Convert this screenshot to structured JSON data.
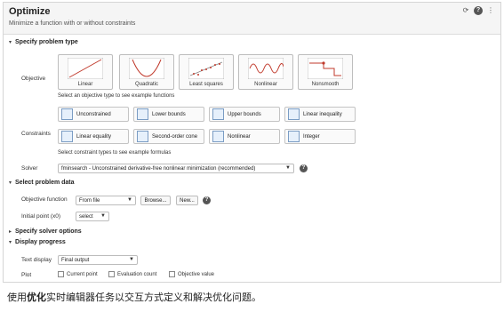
{
  "header": {
    "title": "Optimize",
    "subtitle": "Minimize a function with or without constraints"
  },
  "sections": {
    "problem_type": "Specify problem type",
    "problem_data": "Select problem data",
    "solver_options": "Specify solver options",
    "display_progress": "Display progress"
  },
  "objective": {
    "label": "Objective",
    "tiles": [
      "Linear",
      "Quadratic",
      "Least squares",
      "Nonlinear",
      "Nonsmooth"
    ],
    "hint": "Select an objective type to see example functions"
  },
  "constraints": {
    "label": "Constraints",
    "buttons": [
      "Unconstrained",
      "Lower bounds",
      "Upper bounds",
      "Linear inequality",
      "Linear equality",
      "Second-order cone",
      "Nonlinear",
      "Integer"
    ],
    "hint": "Select constraint types to see example formulas"
  },
  "solver": {
    "label": "Solver",
    "value": "fminsearch - Unconstrained derivative-free nonlinear minimization (recommended)"
  },
  "problem_data": {
    "objective_function_label": "Objective function",
    "objective_function_value": "From file",
    "browse_label": "Browse...",
    "new_label": "New...",
    "initial_point_label": "Initial point (x0)",
    "initial_point_value": "select"
  },
  "display": {
    "text_display_label": "Text display",
    "text_display_value": "Final output",
    "plot_label": "Plot",
    "plot_options": [
      "Current point",
      "Evaluation count",
      "Objective value"
    ]
  },
  "caption": {
    "before": "使用",
    "bold": "优化",
    "after": "实时编辑器任务以交互方式定义和解决优化问题。"
  },
  "colors": {
    "accent": "#c0392b",
    "border": "#d6d6d6",
    "header_bg": "#f5f5f5"
  }
}
